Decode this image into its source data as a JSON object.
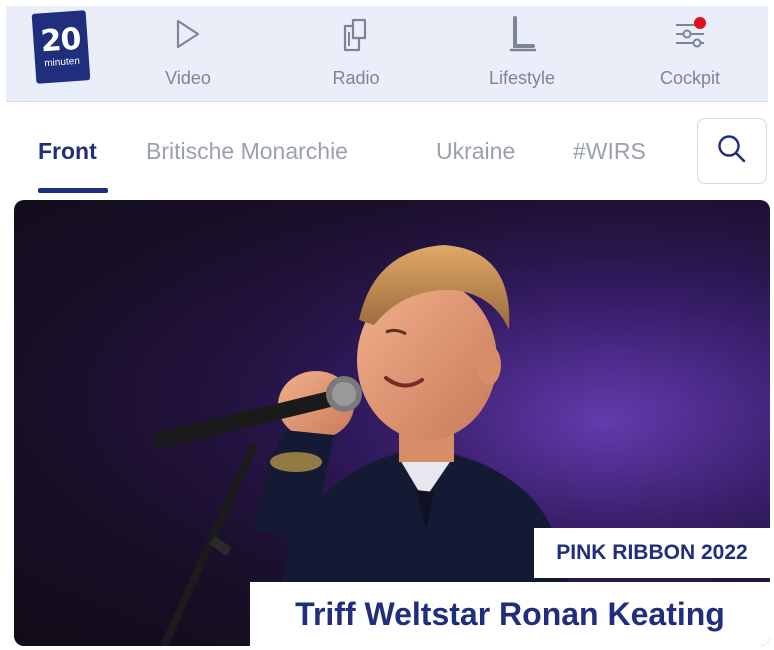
{
  "logo": {
    "number": "20",
    "subtitle": "minuten"
  },
  "nav": {
    "items": [
      {
        "label": "Video",
        "icon": "play-icon"
      },
      {
        "label": "Radio",
        "icon": "radio-icon"
      },
      {
        "label": "Lifestyle",
        "icon": "lifestyle-icon"
      },
      {
        "label": "Cockpit",
        "icon": "sliders-icon",
        "notification_dot": true
      }
    ]
  },
  "tabs": [
    {
      "label": "Front",
      "active": true
    },
    {
      "label": "Britische Monarchie",
      "active": false
    },
    {
      "label": "Ukraine",
      "active": false
    },
    {
      "label": "#WIRS",
      "active": false
    }
  ],
  "search": {
    "icon": "search-icon"
  },
  "hero": {
    "kicker": "PINK RIBBON 2022",
    "headline": "Triff Weltstar Ronan Keating"
  },
  "colors": {
    "brand_navy": "#1f2e7d",
    "nav_background": "#e9eef9",
    "notification_red": "#e0111b",
    "inactive_text": "#9aa0ac"
  }
}
